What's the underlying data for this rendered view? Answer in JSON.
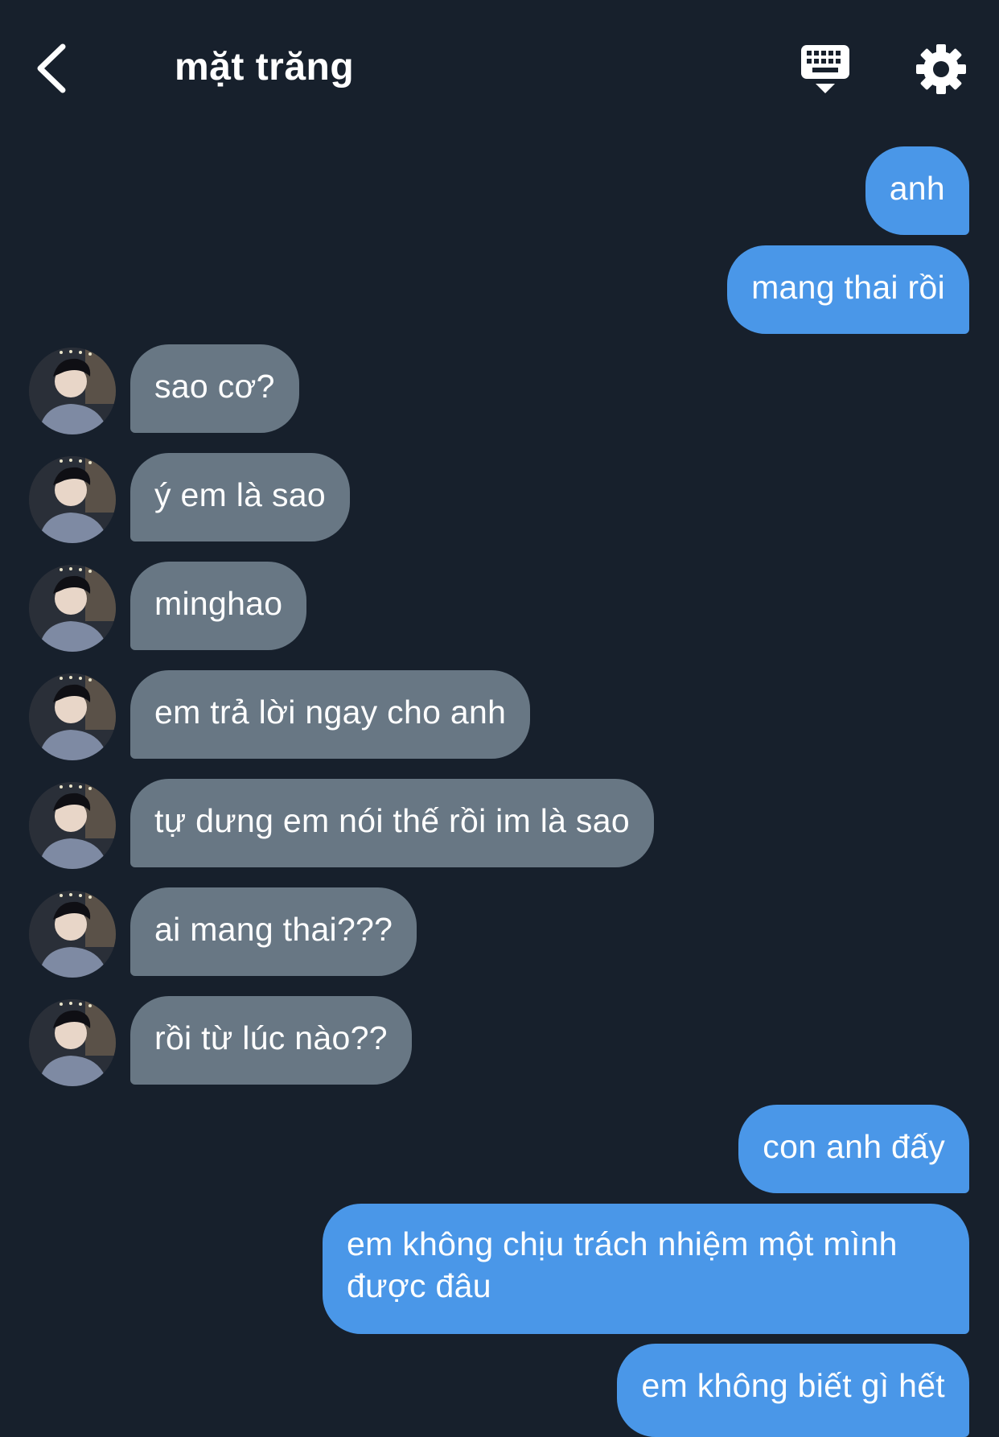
{
  "header": {
    "title": "mặt trăng"
  },
  "messages": [
    {
      "from": "me",
      "text": "anh"
    },
    {
      "from": "me",
      "text": "mang thai rồi"
    },
    {
      "from": "them",
      "text": "sao cơ?"
    },
    {
      "from": "them",
      "text": "ý em là sao"
    },
    {
      "from": "them",
      "text": "minghao"
    },
    {
      "from": "them",
      "text": "em trả lời ngay cho anh"
    },
    {
      "from": "them",
      "text": "tự dưng em nói thế rồi im là sao"
    },
    {
      "from": "them",
      "text": "ai mang thai???"
    },
    {
      "from": "them",
      "text": "rồi từ lúc nào??"
    },
    {
      "from": "me",
      "text": "con anh đấy"
    },
    {
      "from": "me",
      "text": "em không chịu trách nhiệm một mình được đâu"
    },
    {
      "from": "me",
      "text": "em không biết gì hết"
    }
  ],
  "colors": {
    "background": "#17202c",
    "sent_bubble": "#4a97e8",
    "received_bubble": "#687784"
  },
  "icons": {
    "back": "chevron-left-icon",
    "keyboard": "keyboard-icon",
    "settings": "gear-icon"
  }
}
